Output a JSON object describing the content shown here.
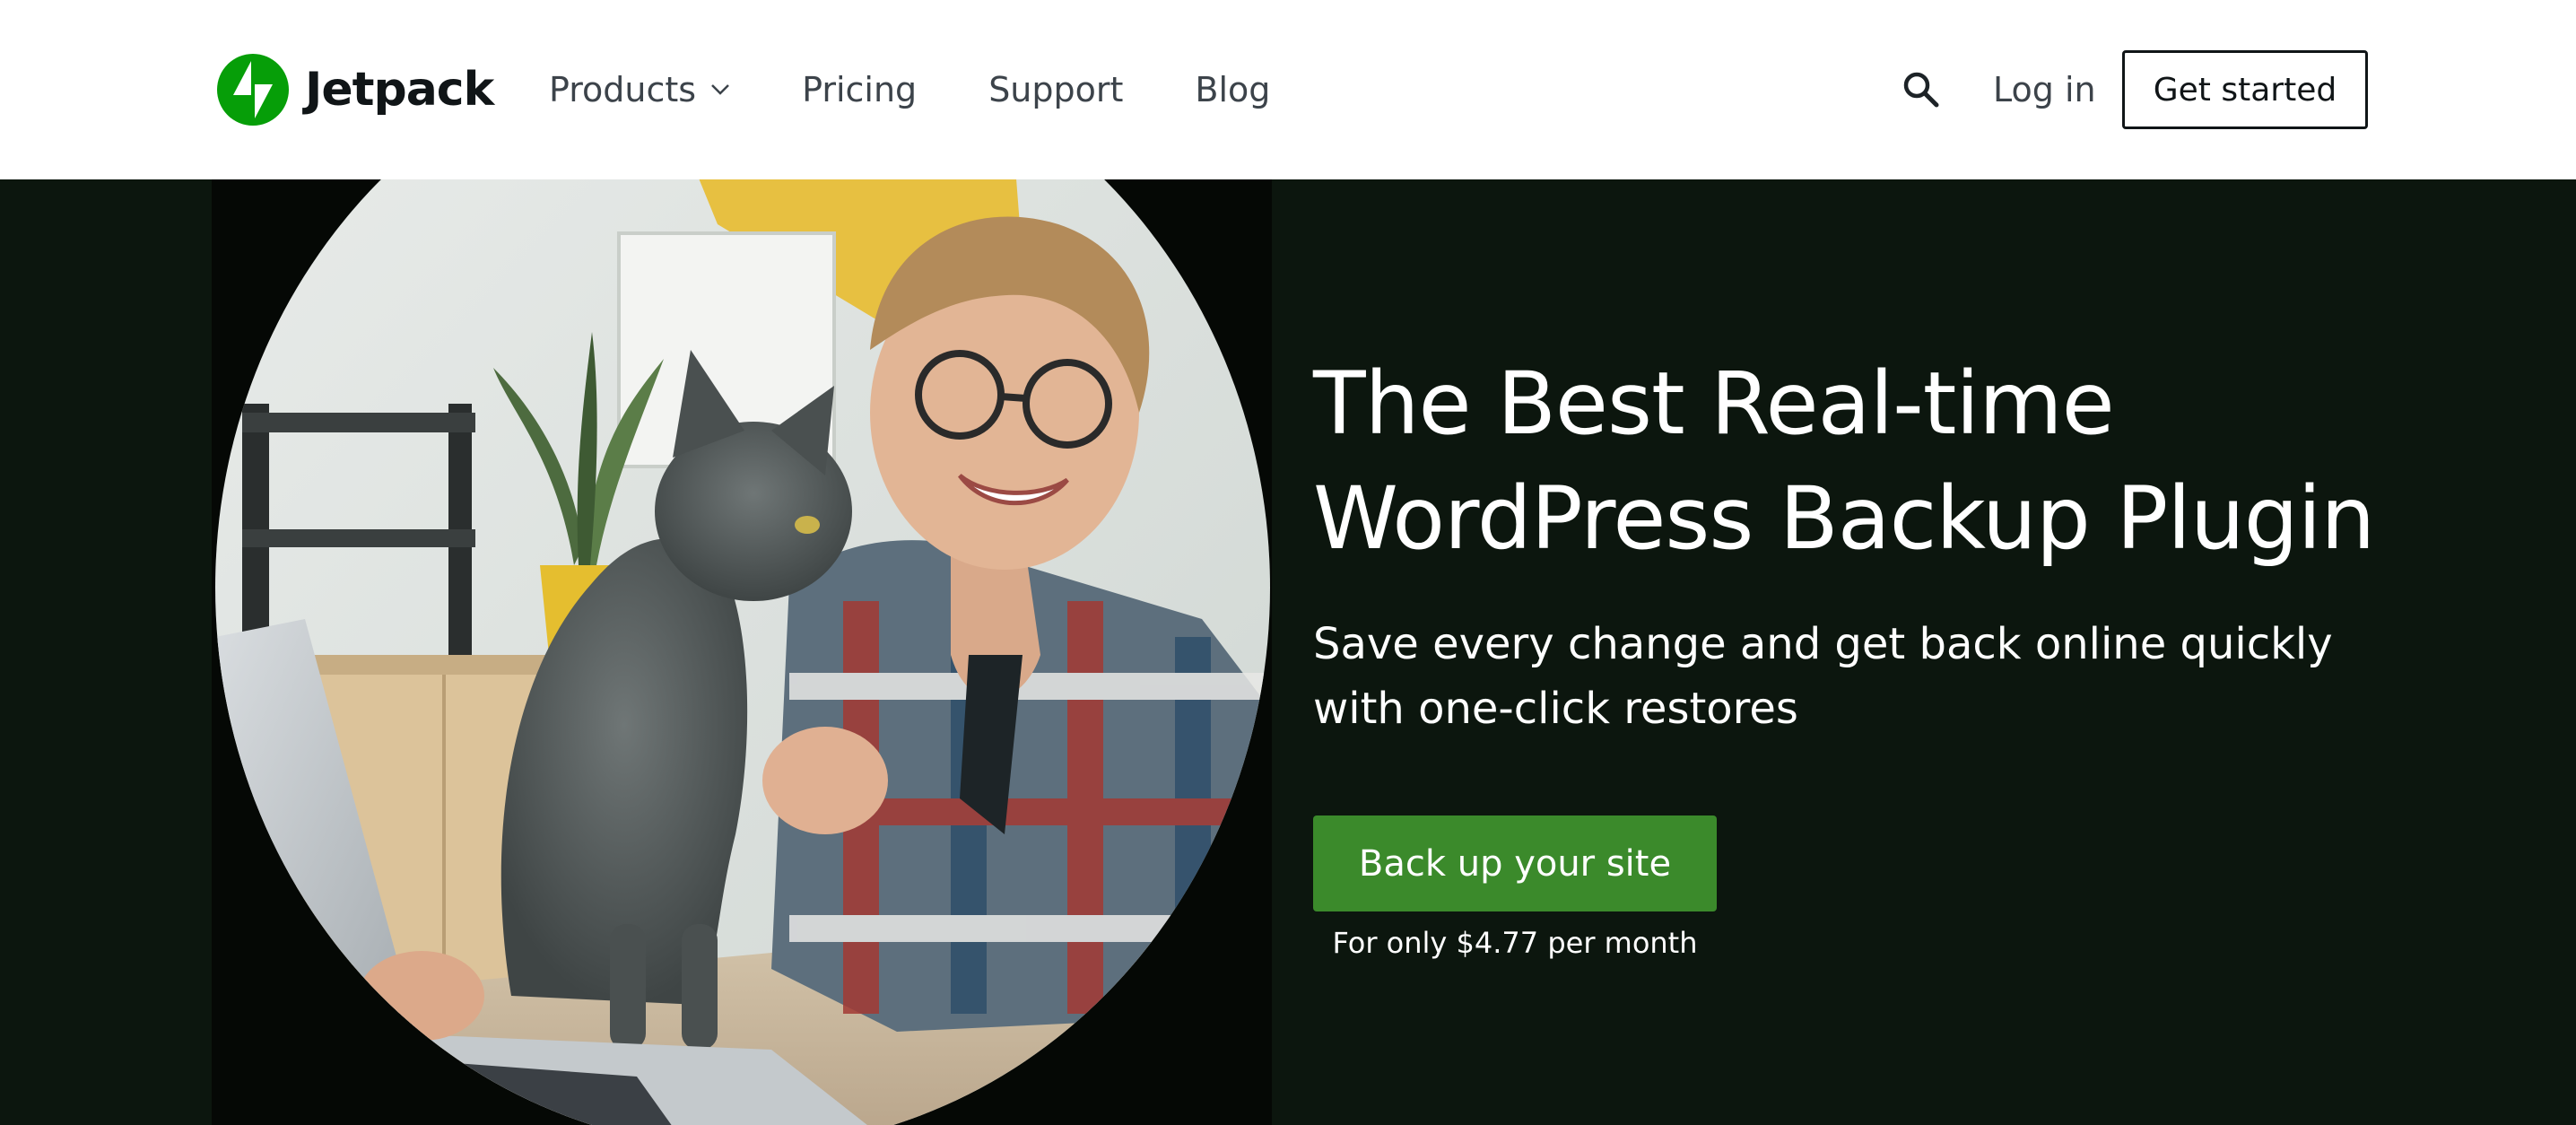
{
  "header": {
    "logo_text": "Jetpack",
    "nav": [
      {
        "label": "Products",
        "has_dropdown": true
      },
      {
        "label": "Pricing"
      },
      {
        "label": "Support"
      },
      {
        "label": "Blog"
      }
    ],
    "search_icon": "search-icon",
    "login_label": "Log in",
    "get_started_label": "Get started"
  },
  "hero": {
    "title_line1": "The Best Real-time",
    "title_line2": "WordPress Backup Plugin",
    "subtitle": "Save every change and get back online quickly with one-click restores",
    "cta_label": "Back up your site",
    "price_note": "For only $4.77 per month"
  },
  "colors": {
    "brand_green": "#069e08",
    "cta_green": "#3b8a2b",
    "hero_background": "#0c160e",
    "header_background": "#ffffff",
    "text_dark": "#101517"
  }
}
